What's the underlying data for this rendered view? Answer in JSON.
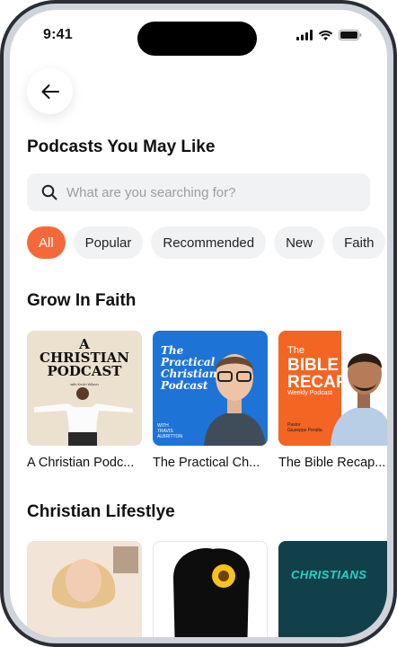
{
  "status_bar": {
    "time": "9:41"
  },
  "header": {
    "title": "Podcasts You May Like"
  },
  "search": {
    "placeholder": "What are you searching for?"
  },
  "filters": [
    "All",
    "Popular",
    "Recommended",
    "New",
    "Faith"
  ],
  "sections": [
    {
      "title": "Grow In Faith",
      "items": [
        {
          "label": "A Christian Podc...",
          "art_lines": [
            "A",
            "CHRISTIAN",
            "PODCAST"
          ],
          "art_small": "with Kevin Wilson"
        },
        {
          "label": "The Practical Ch...",
          "art_lines": [
            "The",
            "Practical",
            "Christian",
            "Podcast"
          ],
          "art_small": [
            "WITH",
            "TRAVIS",
            "ALBRITTON"
          ]
        },
        {
          "label": "The Bible Recap...",
          "art_lines": [
            "The",
            "BIBLE",
            "RECAP"
          ],
          "art_small": "Weekly Podcast",
          "host": [
            "Pastor",
            "Giuseppe Peralta"
          ]
        }
      ]
    },
    {
      "title": "Christian Lifestlye",
      "items": [
        {
          "label": ""
        },
        {
          "label": ""
        },
        {
          "label": "",
          "art_lines": [
            "CHRISTIANS"
          ]
        }
      ]
    }
  ],
  "colors": {
    "accent": "#f4693b",
    "chip_bg": "#f1f2f4",
    "search_bg": "#f1f2f4"
  },
  "icons": {
    "back": "arrow-left-icon",
    "search": "search-icon",
    "signal": "signal-icon",
    "wifi": "wifi-icon",
    "battery": "battery-icon"
  }
}
